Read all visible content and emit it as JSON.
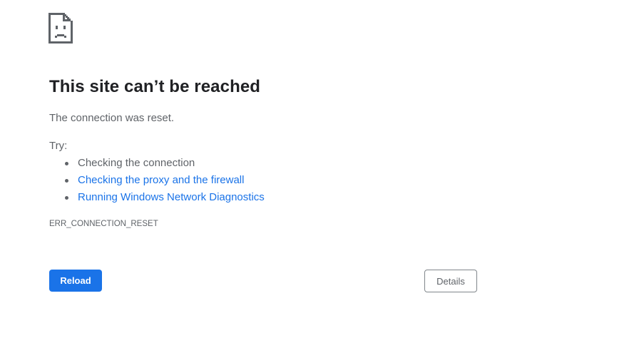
{
  "error": {
    "icon": "sad-document-icon",
    "title": "This site can’t be reached",
    "message": "The connection was reset.",
    "try_label": "Try:",
    "suggestions": [
      {
        "text": "Checking the connection",
        "is_link": false
      },
      {
        "text": "Checking the proxy and the firewall",
        "is_link": true
      },
      {
        "text": "Running Windows Network Diagnostics",
        "is_link": true
      }
    ],
    "code": "ERR_CONNECTION_RESET"
  },
  "buttons": {
    "reload_label": "Reload",
    "details_label": "Details"
  },
  "colors": {
    "accent": "#1a73e8",
    "title": "#202124",
    "text": "#5f6368",
    "border": "#80868b"
  }
}
